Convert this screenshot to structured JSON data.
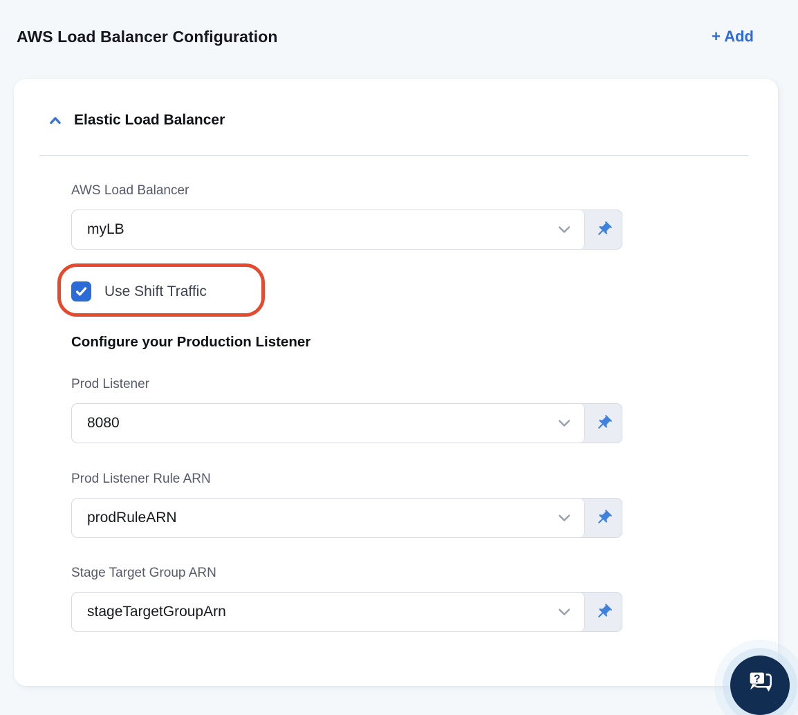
{
  "header": {
    "title": "AWS Load Balancer Configuration",
    "add_button": "+ Add"
  },
  "panel": {
    "section": {
      "title": "Elastic Load Balancer",
      "state": "expanded"
    },
    "fields": [
      {
        "label": "AWS Load Balancer",
        "value": "myLB"
      },
      {
        "label": "Prod Listener",
        "value": "8080"
      },
      {
        "label": "Prod Listener Rule ARN",
        "value": "prodRuleARN"
      },
      {
        "label": "Stage Target Group ARN",
        "value": "stageTargetGroupArn"
      }
    ],
    "use_shift_traffic": {
      "label": "Use Shift Traffic",
      "checked": true
    },
    "production_listener_heading": "Configure your Production Listener"
  },
  "annotation": {
    "shape": "rounded-rectangle",
    "color": "#e64a2e",
    "highlights": "Use Shift Traffic checkbox"
  },
  "icons": {
    "collapse": "chevron-up-icon",
    "dropdown": "chevron-down-icon",
    "pin": "pushpin-icon",
    "check": "checkmark-icon",
    "help": "chat-question-icon"
  },
  "colors": {
    "accent_blue": "#2e6bd6",
    "checkbox_blue": "#2a6bd7",
    "pin_blue": "#3f82de",
    "annotation_red": "#e64a2e",
    "fab_navy": "#112d52",
    "page_background": "#f4f8fb",
    "card_background": "#ffffff"
  }
}
